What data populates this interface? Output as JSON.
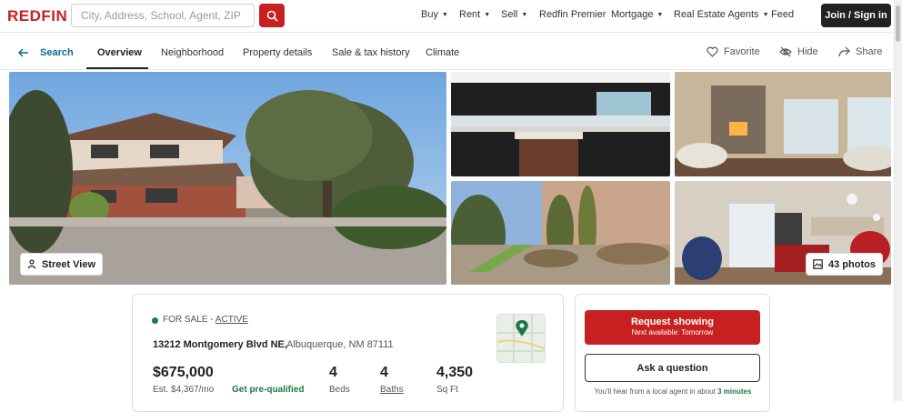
{
  "header": {
    "logo": "REDFIN",
    "search_placeholder": "City, Address, School, Agent, ZIP",
    "nav": [
      {
        "label": "Buy",
        "caret": true
      },
      {
        "label": "Rent",
        "caret": true
      },
      {
        "label": "Sell",
        "caret": true
      },
      {
        "label": "Redfin Premier",
        "caret": false
      },
      {
        "label": "Mortgage",
        "caret": true
      },
      {
        "label": "Real Estate Agents",
        "caret": true
      },
      {
        "label": "Feed",
        "caret": false
      }
    ],
    "signin_label": "Join / Sign in"
  },
  "subnav": {
    "back_label": "Search",
    "tabs": [
      "Overview",
      "Neighborhood",
      "Property details",
      "Sale & tax history",
      "Climate"
    ],
    "actions": {
      "favorite": "Favorite",
      "hide": "Hide",
      "share": "Share"
    }
  },
  "photos": {
    "street_view_label": "Street View",
    "photo_count_label": "43 photos"
  },
  "listing": {
    "status_prefix": "FOR SALE - ",
    "status_active": "ACTIVE",
    "street": "13212 Montgomery Blvd NE,",
    "city": "Albuquerque, NM 87111",
    "price": "$675,000",
    "est_payment": "Est. $4,367/mo",
    "prequal_link": "Get pre-qualified",
    "beds_value": "4",
    "beds_label": "Beds",
    "baths_value": "4",
    "baths_label": "Baths",
    "sqft_value": "4,350",
    "sqft_label": "Sq Ft"
  },
  "contact": {
    "request_label": "Request showing",
    "request_sub": "Next available: Tomorrow",
    "ask_label": "Ask a question",
    "note_prefix": "You'll hear from a local agent in about ",
    "note_time": "3 minutes"
  },
  "colors": {
    "brand_red": "#c82021",
    "green": "#1b7a46",
    "dark": "#222222"
  }
}
